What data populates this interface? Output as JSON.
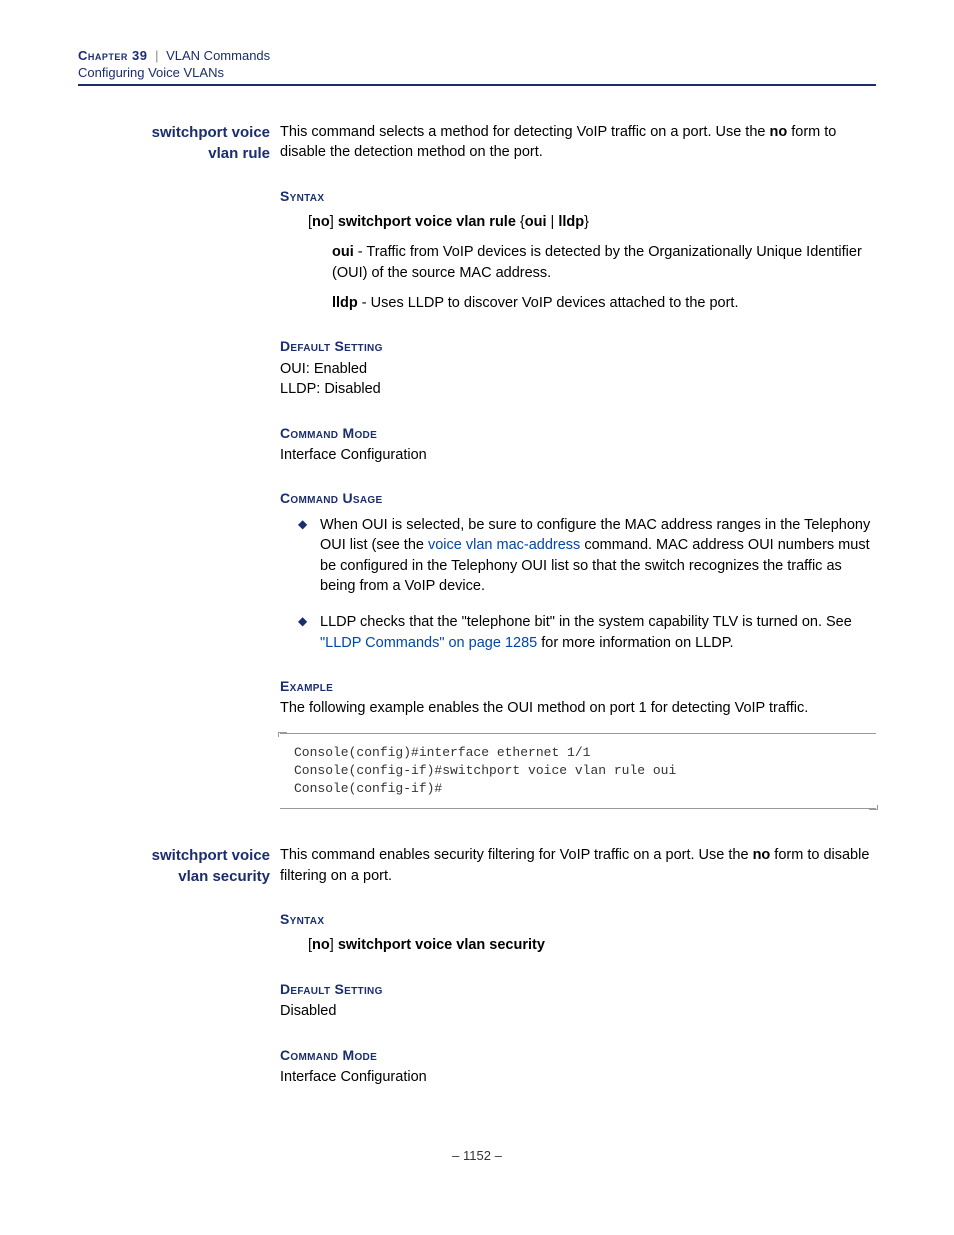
{
  "header": {
    "chapter": "Chapter 39",
    "pipe": "|",
    "title": "VLAN Commands",
    "subtitle": "Configuring Voice VLANs"
  },
  "cmd1": {
    "side1": "switchport voice",
    "side2": "vlan rule",
    "intro_a": "This command selects a method for detecting VoIP traffic on a port. Use the ",
    "intro_no": "no",
    "intro_b": " form to disable the detection method on the port.",
    "h_syntax": "Syntax",
    "syn_open": "[",
    "syn_no": "no",
    "syn_close": "] ",
    "syn_main": "switchport voice vlan rule",
    "syn_brace_o": " {",
    "syn_oui": "oui",
    "syn_bar": " | ",
    "syn_lldp": "lldp",
    "syn_brace_c": "}",
    "oui_lbl": "oui",
    "oui_txt": " - Traffic from VoIP devices is detected by the Organizationally Unique Identifier (OUI) of the source MAC address.",
    "lldp_lbl": "lldp",
    "lldp_txt": " - Uses LLDP to discover VoIP devices attached to the port.",
    "h_default": "Default Setting",
    "def1": "OUI: Enabled",
    "def2": "LLDP: Disabled",
    "h_mode": "Command Mode",
    "mode": "Interface Configuration",
    "h_usage": "Command Usage",
    "usage1a": "When OUI is selected, be sure to configure the MAC address ranges in the Telephony OUI list (see the ",
    "usage1link": "voice vlan mac-address",
    "usage1b": " command. MAC address OUI numbers must be configured in the Telephony OUI list so that the switch recognizes the traffic as being from a VoIP device.",
    "usage2a": "LLDP checks that the \"telephone bit\" in the system capability TLV is turned on. See ",
    "usage2link": "\"LLDP Commands\" on page 1285",
    "usage2b": " for more information on LLDP.",
    "h_example": "Example",
    "example_intro": "The following example enables the OUI method on port 1 for detecting VoIP traffic.",
    "code": "Console(config)#interface ethernet 1/1\nConsole(config-if)#switchport voice vlan rule oui\nConsole(config-if)#"
  },
  "cmd2": {
    "side1": "switchport voice",
    "side2": "vlan security",
    "intro_a": "This command enables security filtering for VoIP traffic on a port. Use the ",
    "intro_no": "no",
    "intro_b": " form to disable filtering on a port.",
    "h_syntax": "Syntax",
    "syn_open": "[",
    "syn_no": "no",
    "syn_close": "] ",
    "syn_main": "switchport voice vlan security",
    "h_default": "Default Setting",
    "def1": "Disabled",
    "h_mode": "Command Mode",
    "mode": "Interface Configuration"
  },
  "footer": {
    "page": "–  1152  –"
  }
}
